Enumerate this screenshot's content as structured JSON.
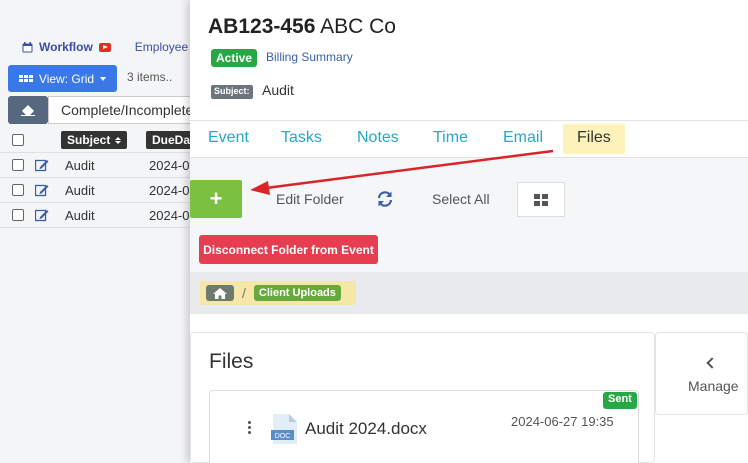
{
  "background": {
    "nav": {
      "workflow": "Workflow",
      "employee": "Employee"
    },
    "view_button": "View: Grid",
    "item_count": "3 items..",
    "filter_value": "Complete/Incomplete",
    "table": {
      "headers": {
        "subject": "Subject",
        "due": "DueDate"
      },
      "rows": [
        {
          "subject": "Audit",
          "due": "2024-0"
        },
        {
          "subject": "Audit",
          "due": "2024-0"
        },
        {
          "subject": "Audit",
          "due": "2024-0"
        }
      ]
    }
  },
  "panel": {
    "title_code": "AB123-456",
    "title_name": "ABC Co",
    "status": "Active",
    "billing_link": "Billing Summary",
    "subject_label": "Subject:",
    "subject_value": "Audit",
    "tabs": [
      "Event",
      "Tasks",
      "Notes",
      "Time",
      "Email",
      "Files"
    ],
    "active_tab": "Files",
    "toolbar": {
      "add": "+",
      "edit_folder": "Edit Folder",
      "select_all": "Select All",
      "disconnect": "Disconnect Folder from Event"
    },
    "breadcrumb": {
      "separator": "/",
      "folder": "Client Uploads"
    },
    "files": {
      "heading": "Files",
      "items": [
        {
          "name": "Audit 2024.docx",
          "date": "2024-06-27 19:35",
          "status": "Sent",
          "icon_label": "DOC"
        }
      ]
    },
    "manage_label": "Manage"
  },
  "colors": {
    "accent_blue": "#3b78e7",
    "tab_text": "#24a9c9",
    "active_tab_bg": "#fdf2b9",
    "green": "#28a745",
    "add_green": "#7cc042",
    "danger": "#e63e50",
    "annotation_arrow": "#d9252a"
  },
  "icons": [
    "calendar-icon",
    "youtube-icon",
    "grid-icon",
    "eraser-icon",
    "edit-icon",
    "refresh-icon",
    "tiles-icon",
    "home-icon",
    "kebab-icon",
    "doc-file-icon",
    "chevron-left-icon"
  ]
}
